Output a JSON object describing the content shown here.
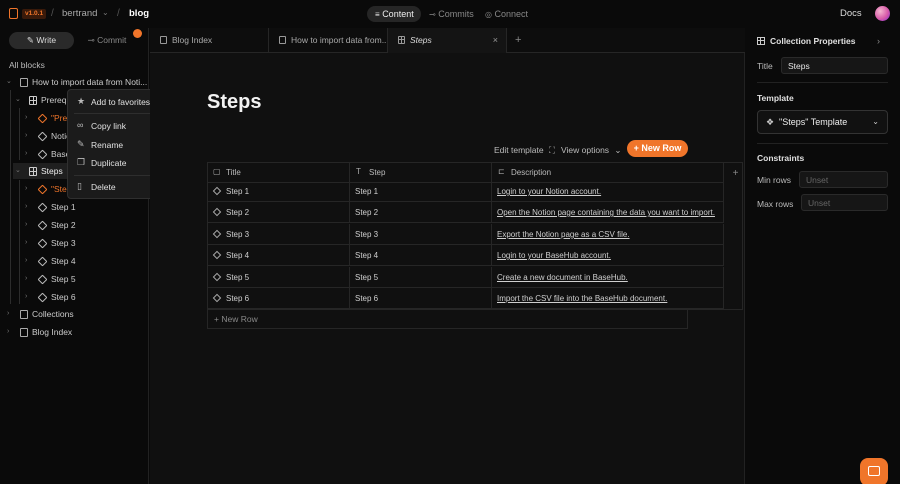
{
  "topbar": {
    "version": "v1.0.1",
    "org": "bertrand",
    "repo": "blog",
    "segments": [
      "Content",
      "Commits",
      "Connect"
    ],
    "docs": "Docs"
  },
  "sidebar": {
    "tabs": {
      "write": "Write",
      "commit": "Commit"
    },
    "section_title": "All blocks",
    "tree": {
      "root": "How to import data from Noti...",
      "prereq": "Prereq",
      "prereq_item": "\"Pre",
      "notion": "Notio",
      "basehub": "Base",
      "steps": "Steps",
      "steps_template": "\"Ste",
      "step_items": [
        "Step 1",
        "Step 2",
        "Step 3",
        "Step 4",
        "Step 5",
        "Step 6"
      ],
      "collections": "Collections",
      "blog_index": "Blog Index"
    }
  },
  "context_menu": {
    "add_favorites": "Add to favorites",
    "copy_link": "Copy link",
    "rename": "Rename",
    "duplicate": "Duplicate",
    "delete": "Delete"
  },
  "editor": {
    "tabs": [
      "Blog Index",
      "How to import data from...",
      "Steps"
    ],
    "page_title": "Steps",
    "toolbar": {
      "edit_template": "Edit template",
      "view_options": "View options",
      "new_row": "New Row"
    },
    "columns": [
      "Title",
      "Step",
      "Description"
    ],
    "rows": [
      {
        "title": "Step 1",
        "step": "Step 1",
        "description": "Login to your Notion account."
      },
      {
        "title": "Step 2",
        "step": "Step 2",
        "description": "Open the Notion page containing the data you want to import."
      },
      {
        "title": "Step 3",
        "step": "Step 3",
        "description": "Export the Notion page as a CSV file."
      },
      {
        "title": "Step 4",
        "step": "Step 4",
        "description": "Login to your BaseHub account."
      },
      {
        "title": "Step 5",
        "step": "Step 5",
        "description": "Create a new document in BaseHub."
      },
      {
        "title": "Step 6",
        "step": "Step 6",
        "description": "Import the CSV file into the BaseHub document."
      }
    ],
    "add_row": "New Row"
  },
  "properties": {
    "header": "Collection Properties",
    "title_label": "Title",
    "title_value": "Steps",
    "template_label": "Template",
    "template_value": "\"Steps\" Template",
    "constraints_label": "Constraints",
    "min_rows_label": "Min rows",
    "min_rows_placeholder": "Unset",
    "max_rows_label": "Max rows",
    "max_rows_placeholder": "Unset"
  },
  "colors": {
    "accent": "#f0752a",
    "background": "#0a0a0a"
  }
}
